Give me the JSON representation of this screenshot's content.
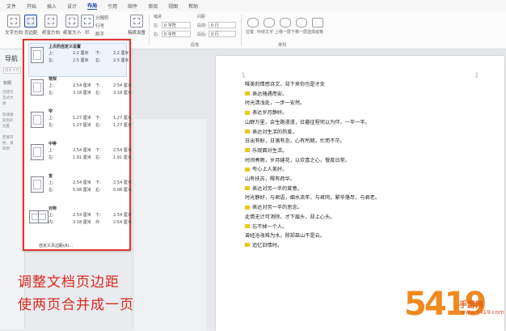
{
  "menu": {
    "items": [
      "文件",
      "开始",
      "插入",
      "设计",
      "布局",
      "引用",
      "邮件",
      "审阅",
      "视图",
      "帮助"
    ],
    "active_index": 4
  },
  "ribbon": {
    "buttons": [
      "文字方向",
      "页边距",
      "纸张方向",
      "纸张大小",
      "栏",
      "稿纸设置"
    ],
    "small_items": [
      "分隔符",
      "行号",
      "断字"
    ],
    "indent_header": "缩进",
    "spacing_header": "间距",
    "indent_left_label": "左:",
    "indent_left_value": "0 字符",
    "indent_right_label": "右:",
    "indent_right_value": "0 字符",
    "spacing_before_label": "段前:",
    "spacing_before_value": "0 行",
    "spacing_after_label": "段后:",
    "spacing_after_value": "0 行",
    "paragraph_group": "段落",
    "arrange_group": "排列",
    "arrange_buttons": [
      "位置",
      "环绕文字",
      "上移一层",
      "下移一层",
      "选择窗格"
    ]
  },
  "nav": {
    "title": "导航",
    "search_placeholder": "搜索文档",
    "tab": "标题",
    "hint": [
      "创建交",
      "互式大",
      "纲",
      "",
      "快速跟",
      "踪您的",
      "位置",
      "",
      "若要开",
      "始，请",
      "转到"
    ]
  },
  "margins_menu": {
    "presets": [
      {
        "name": "上次的自定义设置",
        "top": "2.2 厘米",
        "bottom": "2.2 厘米",
        "left": "2.5 厘米",
        "right": "2.5 厘米",
        "labels": [
          "上:",
          "下:",
          "左:",
          "右:"
        ]
      },
      {
        "name": "常规",
        "top": "2.54 厘米",
        "bottom": "2.54 厘米",
        "left": "3.18 厘米",
        "right": "3.18 厘米",
        "labels": [
          "上:",
          "下:",
          "左:",
          "右:"
        ]
      },
      {
        "name": "窄",
        "top": "1.27 厘米",
        "bottom": "1.27 厘米",
        "left": "1.27 厘米",
        "right": "1.27 厘米",
        "labels": [
          "上:",
          "下:",
          "左:",
          "右:"
        ]
      },
      {
        "name": "中等",
        "top": "2.54 厘米",
        "bottom": "2.54 厘米",
        "left": "1.91 厘米",
        "right": "1.91 厘米",
        "labels": [
          "上:",
          "下:",
          "左:",
          "右:"
        ]
      },
      {
        "name": "宽",
        "top": "2.54 厘米",
        "bottom": "2.54 厘米",
        "left": "5.08 厘米",
        "right": "5.08 厘米",
        "labels": [
          "上:",
          "下:",
          "左:",
          "右:"
        ]
      },
      {
        "name": "对称",
        "top": "2.54 厘米",
        "bottom": "2.54 厘米",
        "left": "3.18 厘米",
        "right": "2.54 厘米",
        "labels": [
          "上:",
          "下:",
          "内:",
          "外:"
        ]
      }
    ],
    "custom": "自定义页边距(A)..."
  },
  "document": {
    "lines": [
      {
        "text": "唯美的情感诗文，背下来你也是才女",
        "title": false
      },
      {
        "text": "表达随遇而安。",
        "title": true
      },
      {
        "text": "时光清浅处，一步一安然。",
        "title": false
      },
      {
        "text": "表达岁月静好。",
        "title": true
      },
      {
        "text": "山野万里，余生路漫漫，日暮征程何以为伴，一半一半。",
        "title": false
      },
      {
        "text": "表达对生活的热爱。",
        "title": true
      },
      {
        "text": "日出有盼，日落有念，心有所期，忙而不茫。",
        "title": false
      },
      {
        "text": "乐观面对生活。",
        "title": true
      },
      {
        "text": "时间煮雨，岁月缝花，以欢喜之心，慢度日常。",
        "title": false
      },
      {
        "text": "夸心上人美好。",
        "title": true
      },
      {
        "text": "山有扶苏，隰有荷华。",
        "title": false
      },
      {
        "text": "表达对另一半的爱意。",
        "title": true
      },
      {
        "text": "时光静好，与君语，细水流年，与君同，繁华落尽，与君老。",
        "title": false
      },
      {
        "text": "表达对另一半的思念。",
        "title": true
      },
      {
        "text": "此情无计可消除，才下眉头，却上心头。",
        "title": false
      },
      {
        "text": "忘不掉一个人。",
        "title": true
      },
      {
        "text": "曾经沧海难为水，除却巫山不是云。",
        "title": false
      },
      {
        "text": "追忆旧情时。",
        "title": true
      }
    ]
  },
  "overlay": {
    "line1": "调整文档页边距",
    "line2": "使两页合并成一页"
  },
  "watermark": {
    "big": "5419",
    "site": "手游网",
    "url": "www.5419.com"
  }
}
